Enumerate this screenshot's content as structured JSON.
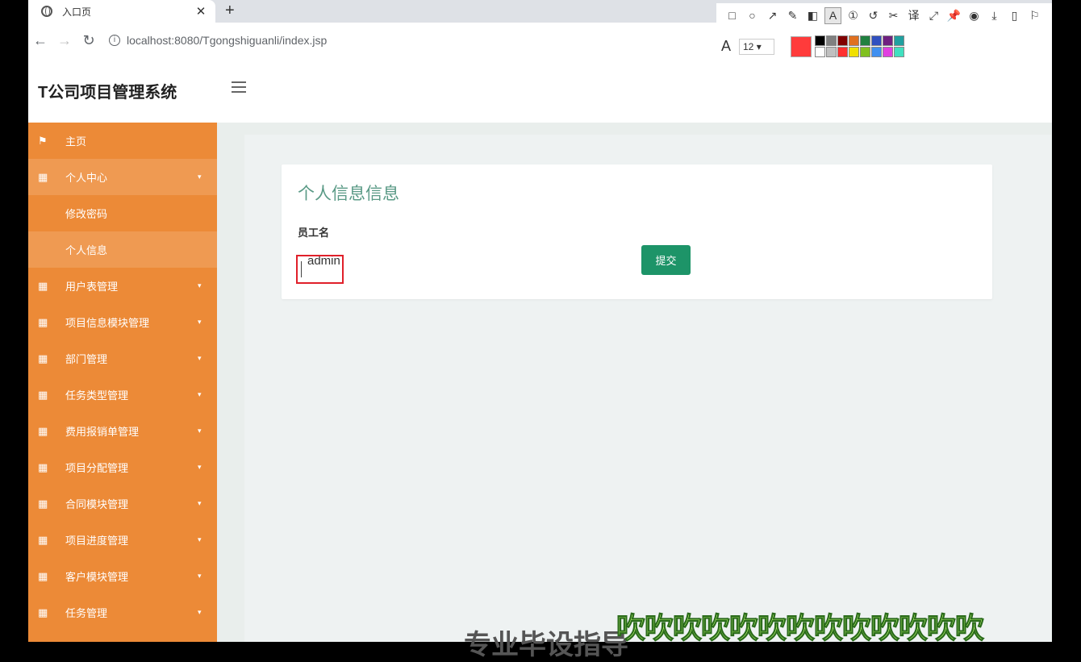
{
  "browser": {
    "tab_title": "入口页",
    "tab_close": "✕",
    "new_tab": "+",
    "back": "←",
    "forward": "→",
    "reload": "↻",
    "url": "localhost:8080/Tgongshiguanli/index.jsp"
  },
  "annotation_toolbar": {
    "tools": [
      "square-icon",
      "circle-icon",
      "arrow-icon",
      "pencil-icon",
      "mosaic-icon",
      "text-icon",
      "number-icon",
      "undo-icon",
      "scissors-icon",
      "translate-icon",
      "fullscreen-icon",
      "pin-icon",
      "record-icon",
      "download-icon",
      "copy-icon",
      "bookmark-icon"
    ],
    "tool_glyphs": [
      "□",
      "○",
      "↗",
      "✎",
      "◧",
      "A",
      "①",
      "↺",
      "✂",
      "译",
      "⤢",
      "📌",
      "◉",
      "⤓",
      "▯",
      "⚐"
    ],
    "font_glyph": "A",
    "font_size": "12",
    "current_color": "#ff3b3b",
    "palette": [
      "#000000",
      "#808080",
      "#800000",
      "#e07020",
      "#208040",
      "#3050c0",
      "#702080",
      "#20a0a0",
      "#ffffff",
      "#c0c0c0",
      "#ff3030",
      "#f0e000",
      "#80c020",
      "#4090f0",
      "#e040e0",
      "#40e0c0"
    ]
  },
  "app": {
    "brand": "T公司项目管理系统",
    "sidebar": [
      {
        "icon": "flag-icon",
        "glyph": "⚑",
        "label": "主页",
        "caret": false,
        "active": false,
        "sub": false
      },
      {
        "icon": "grid-icon",
        "glyph": "▦",
        "label": "个人中心",
        "caret": true,
        "active": true,
        "sub": false
      },
      {
        "icon": "",
        "glyph": "",
        "label": "修改密码",
        "caret": false,
        "active": false,
        "sub": true
      },
      {
        "icon": "",
        "glyph": "",
        "label": "个人信息",
        "caret": false,
        "active": true,
        "sub": true
      },
      {
        "icon": "grid-icon",
        "glyph": "▦",
        "label": "用户表管理",
        "caret": true,
        "active": false,
        "sub": false
      },
      {
        "icon": "grid-icon",
        "glyph": "▦",
        "label": "项目信息模块管理",
        "caret": true,
        "active": false,
        "sub": false
      },
      {
        "icon": "grid-icon",
        "glyph": "▦",
        "label": "部门管理",
        "caret": true,
        "active": false,
        "sub": false
      },
      {
        "icon": "grid-icon",
        "glyph": "▦",
        "label": "任务类型管理",
        "caret": true,
        "active": false,
        "sub": false
      },
      {
        "icon": "grid-icon",
        "glyph": "▦",
        "label": "费用报销单管理",
        "caret": true,
        "active": false,
        "sub": false
      },
      {
        "icon": "grid-icon",
        "glyph": "▦",
        "label": "项目分配管理",
        "caret": true,
        "active": false,
        "sub": false
      },
      {
        "icon": "grid-icon",
        "glyph": "▦",
        "label": "合同模块管理",
        "caret": true,
        "active": false,
        "sub": false
      },
      {
        "icon": "grid-icon",
        "glyph": "▦",
        "label": "项目进度管理",
        "caret": true,
        "active": false,
        "sub": false
      },
      {
        "icon": "grid-icon",
        "glyph": "▦",
        "label": "客户模块管理",
        "caret": true,
        "active": false,
        "sub": false
      },
      {
        "icon": "grid-icon",
        "glyph": "▦",
        "label": "任务管理",
        "caret": true,
        "active": false,
        "sub": false
      }
    ],
    "caret_glyph": "▾",
    "card": {
      "title": "个人信息信息",
      "field_label": "员工名",
      "field_value": "admin",
      "submit_label": "提交"
    }
  },
  "overlay": {
    "bottom_text": "专业毕设指导",
    "watermark": "吹吹吹吹吹吹吹吹吹吹吹吹吹"
  }
}
